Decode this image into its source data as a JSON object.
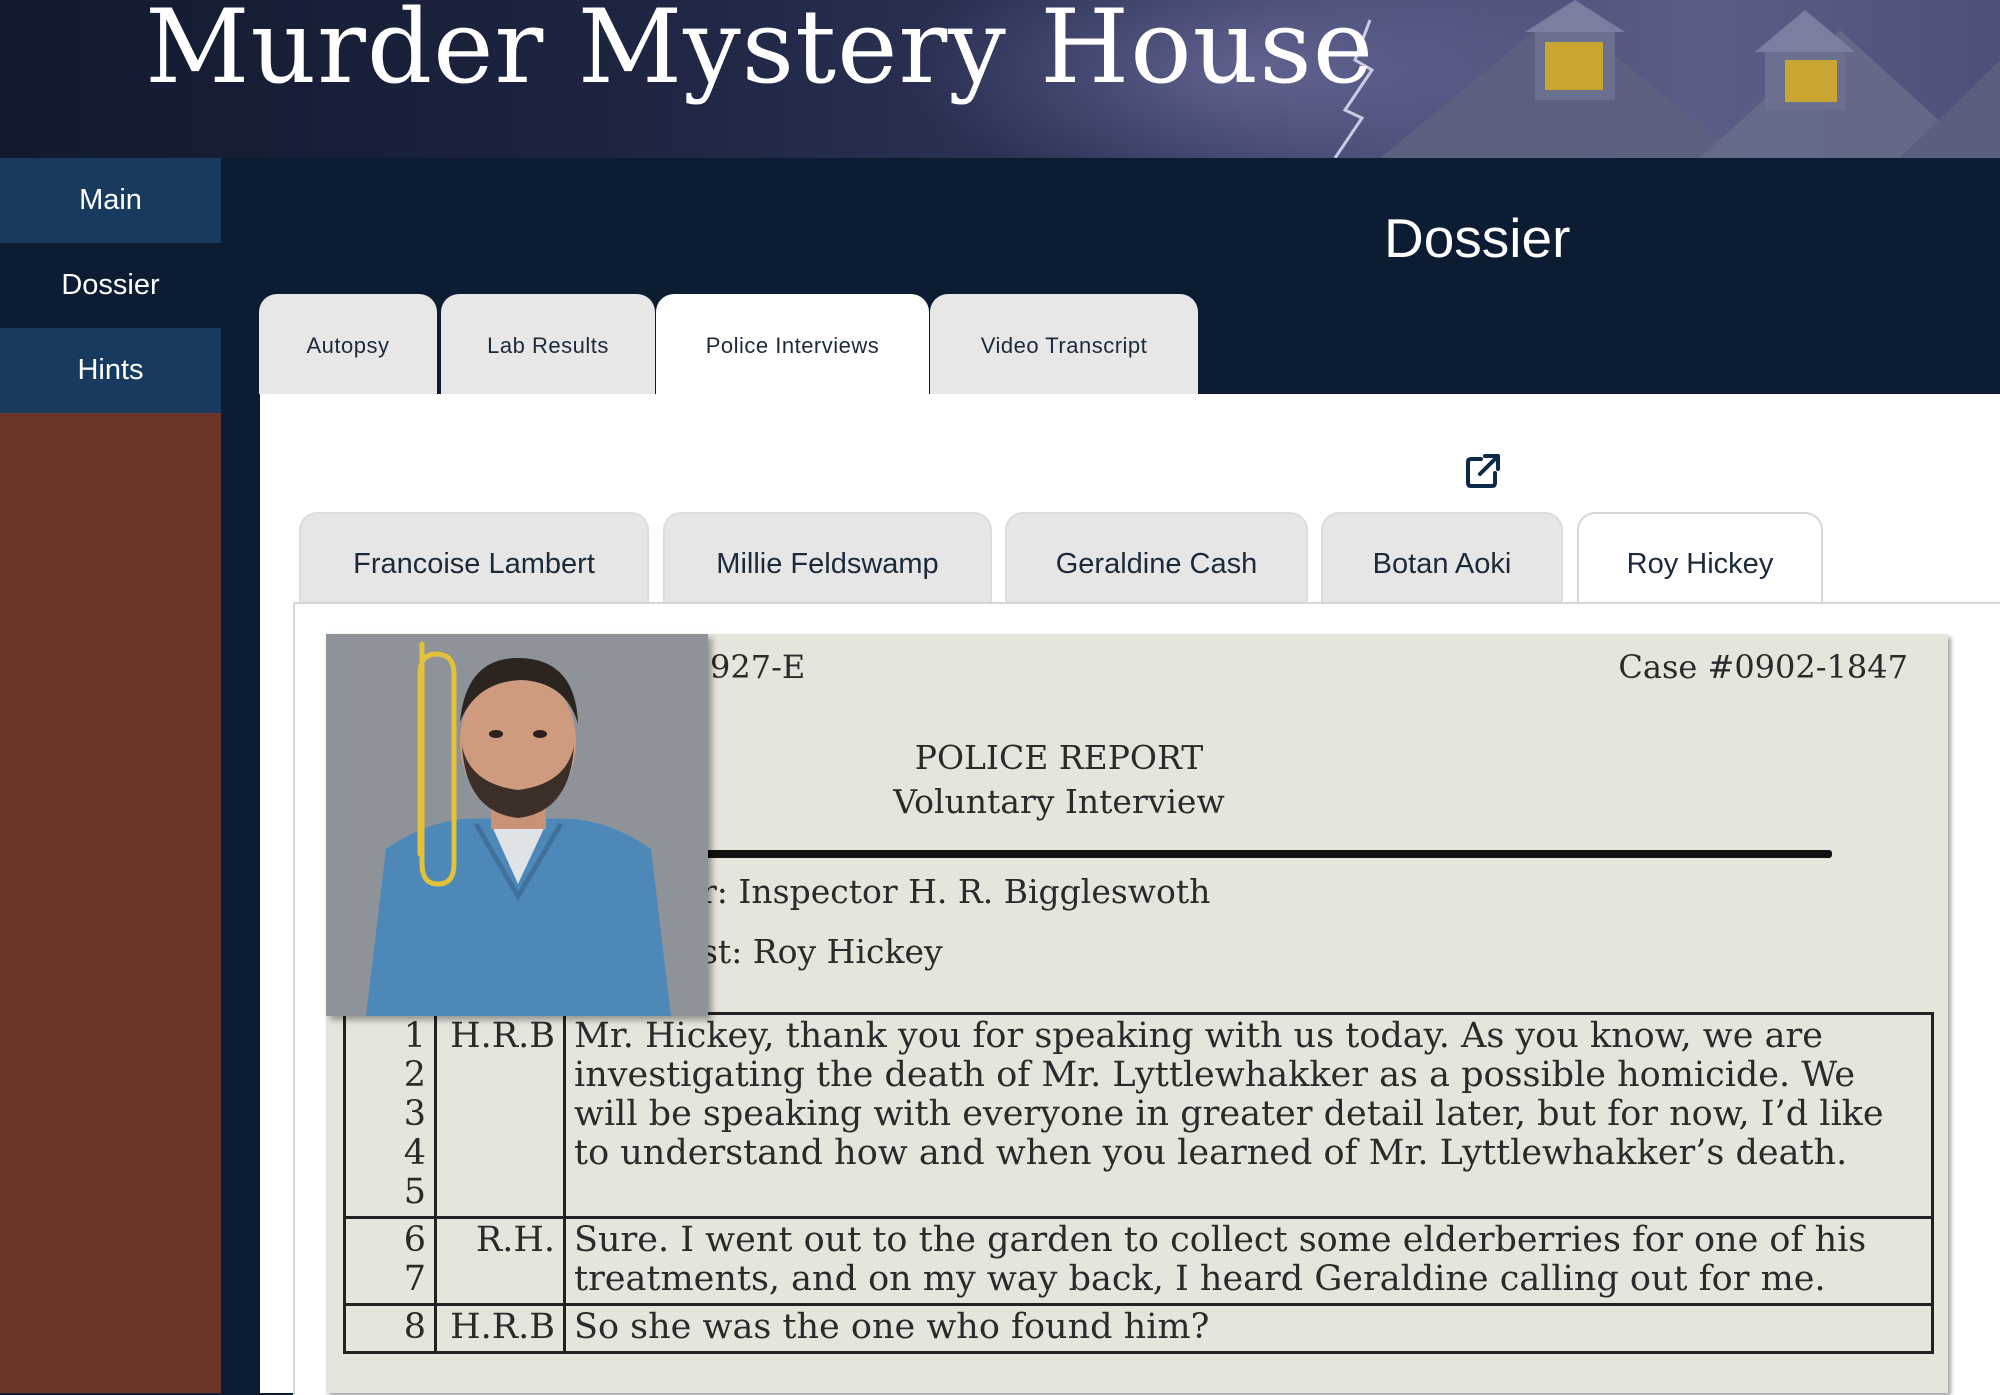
{
  "header": {
    "title": "Murder Mystery House"
  },
  "sidebar": {
    "items": [
      {
        "label": "Main"
      },
      {
        "label": "Dossier"
      },
      {
        "label": "Hints"
      }
    ]
  },
  "main": {
    "title": "Dossier",
    "tabs": [
      {
        "label": "Autopsy",
        "active": false
      },
      {
        "label": "Lab Results",
        "active": false
      },
      {
        "label": "Police Interviews",
        "active": true
      },
      {
        "label": "Video Transcript",
        "active": false
      }
    ],
    "open_external_icon": "external-link-icon",
    "suspect_tabs": [
      {
        "label": "Francoise Lambert",
        "active": false
      },
      {
        "label": "Millie Feldswamp",
        "active": false
      },
      {
        "label": "Geraldine Cash",
        "active": false
      },
      {
        "label": "Botan Aoki",
        "active": false
      },
      {
        "label": "Roy Hickey",
        "active": true
      }
    ]
  },
  "document": {
    "form_number": "927-E",
    "case_number": "Case #0902-1847",
    "report_title": "POLICE REPORT",
    "report_subtitle": "Voluntary Interview",
    "investigator_line": "r: Inspector H. R. Biggleswoth",
    "interviewee_line": "st: Roy Hickey",
    "rows": [
      {
        "lines": [
          "1",
          "2",
          "3",
          "4",
          "5"
        ],
        "speaker": "H.R.B",
        "text": "Mr. Hickey, thank you for speaking with us today.  As you know, we are investigating the death of Mr. Lyttlewhakker as a possible homicide.  We will be speaking with everyone in greater detail later, but for now, I’d like to understand how and when you learned of Mr. Lyttlewhakker’s death."
      },
      {
        "lines": [
          "6",
          "7"
        ],
        "speaker": "R.H.",
        "text": "Sure.  I went out to the garden to collect some elderberries for one of his treatments, and on my way back, I heard Geraldine calling out for me."
      },
      {
        "lines": [
          "8"
        ],
        "speaker": "H.R.B",
        "text": "So she was the one who found him?"
      }
    ]
  },
  "colors": {
    "navy": "#0b1c33",
    "nav_blue": "#183a5e",
    "sidebar_brown": "#6b3527",
    "tab_gray": "#e7e7e7",
    "paper": "#e5e5dc"
  }
}
